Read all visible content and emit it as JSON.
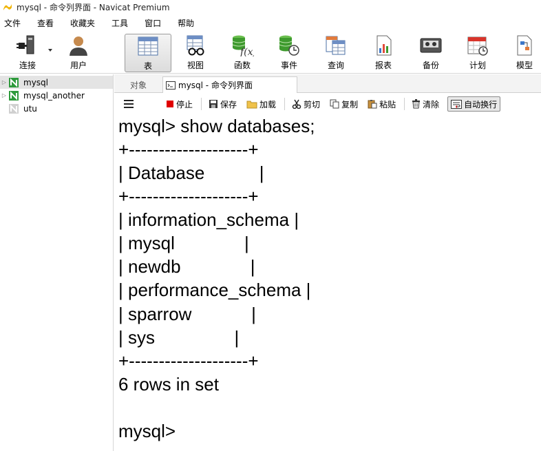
{
  "window": {
    "title": "mysql - 命令列界面 - Navicat Premium"
  },
  "menu": [
    "文件",
    "查看",
    "收藏夹",
    "工具",
    "窗口",
    "帮助"
  ],
  "toolbar": {
    "connect": "连接",
    "user": "用户",
    "table": "表",
    "view": "视图",
    "function": "函数",
    "event": "事件",
    "query": "查询",
    "report": "报表",
    "backup": "备份",
    "schedule": "计划",
    "model": "模型"
  },
  "sidebar": {
    "items": [
      {
        "label": "mysql"
      },
      {
        "label": "mysql_another"
      },
      {
        "label": "utu"
      }
    ]
  },
  "tabs": {
    "objects": "对象",
    "console": "mysql - 命令列界面"
  },
  "console_toolbar": {
    "stop": "停止",
    "save": "保存",
    "load": "加载",
    "cut": "剪切",
    "copy": "复制",
    "paste": "粘贴",
    "clear": "清除",
    "wrap": "自动换行"
  },
  "console": {
    "lines": [
      "mysql> show databases;",
      "+--------------------+",
      "| Database           |",
      "+--------------------+",
      "| information_schema |",
      "| mysql              |",
      "| newdb              |",
      "| performance_schema |",
      "| sparrow            |",
      "| sys                |",
      "+--------------------+",
      "6 rows in set",
      "",
      "mysql>"
    ]
  },
  "colors": {
    "accent_green": "#2e9a3c",
    "stop_red": "#e00000"
  }
}
